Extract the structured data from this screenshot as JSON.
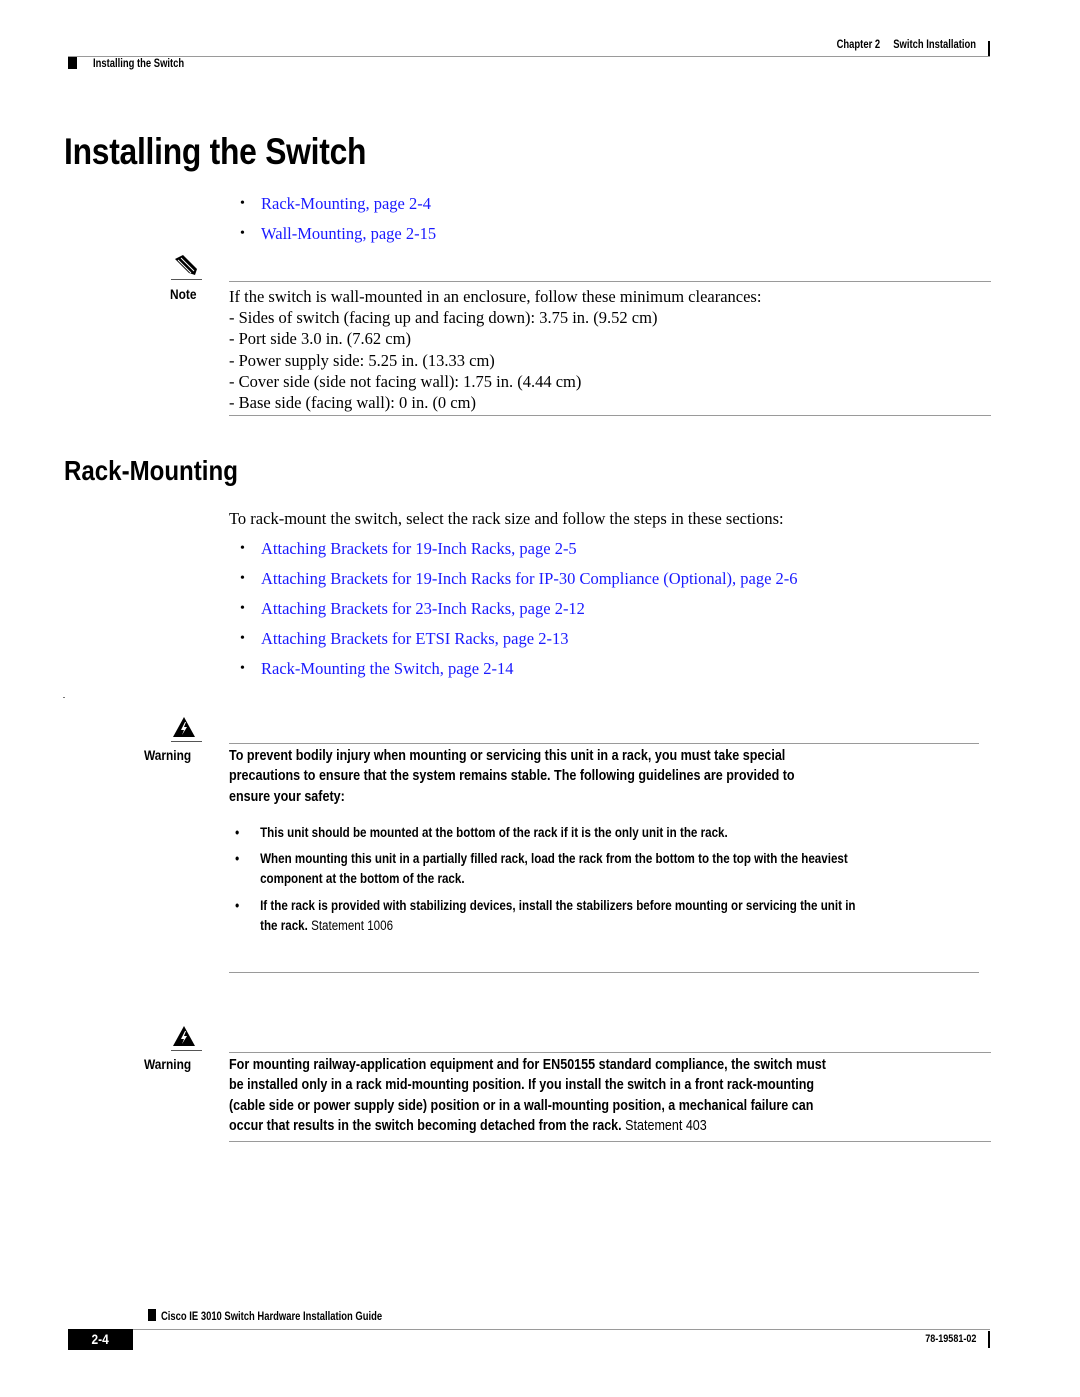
{
  "header": {
    "chapter": "Chapter 2",
    "chapter_title": "Switch Installation",
    "section": "Installing the Switch"
  },
  "title": "Installing the Switch",
  "intro_links": [
    {
      "text": "Rack-Mounting, page 2-4"
    },
    {
      "text": "Wall-Mounting, page 2-15"
    }
  ],
  "note": {
    "icon": "pencil-icon",
    "label": "Note",
    "lines": [
      "If the switch is wall-mounted in an enclosure, follow these minimum clearances:",
      "- Sides of switch (facing up and facing down): 3.75 in. (9.52 cm)",
      "- Port side 3.0 in. (7.62 cm)",
      "- Power supply side: 5.25 in. (13.33 cm)",
      "- Cover side (side not facing wall): 1.75 in. (4.44 cm)",
      "- Base side (facing wall): 0 in. (0 cm)"
    ]
  },
  "rack_section": {
    "heading": "Rack-Mounting",
    "intro": "To rack-mount the switch, select the rack size and follow the steps in these sections:",
    "links": [
      {
        "text": "Attaching Brackets for 19-Inch Racks, page 2-5"
      },
      {
        "text": "Attaching Brackets for 19-Inch Racks for IP-30 Compliance (Optional), page 2-6"
      },
      {
        "text": "Attaching Brackets for 23-Inch Racks, page 2-12"
      },
      {
        "text": "Attaching Brackets for ETSI Racks, page 2-13"
      },
      {
        "text": "Rack-Mounting the Switch, page 2-14"
      }
    ]
  },
  "warning1": {
    "icon": "warning-triangle-icon",
    "label": "Warning",
    "lines": [
      "To prevent bodily injury when mounting or servicing this unit in a rack, you must take special",
      "precautions to ensure that the system remains stable. The following guidelines are provided to",
      "ensure your safety:"
    ],
    "bullets": [
      {
        "lines": [
          "This unit should be mounted at the bottom of the rack if it is the only unit in the rack."
        ]
      },
      {
        "lines": [
          "When mounting this unit in a partially filled rack, load the rack from the bottom to the top with the heaviest",
          "component at the bottom of the rack."
        ]
      },
      {
        "lines": [
          "If the rack is provided with stabilizing devices, install the stabilizers before mounting or servicing the unit in",
          "the rack."
        ],
        "statement": "Statement 1006"
      }
    ]
  },
  "warning2": {
    "icon": "warning-triangle-icon",
    "label": "Warning",
    "lines": [
      "For mounting railway-application equipment and for  EN50155 standard compliance, the switch must",
      "be installed only in a rack mid-mounting position.  If you install the switch in a front rack-mounting",
      "(cable side or power supply side) position or in a wall-mounting position,  a  mechanical failure can",
      "occur that results in the switch becoming detached from the rack."
    ],
    "statement": "Statement 403"
  },
  "footer": {
    "guide_title": "Cisco IE 3010 Switch Hardware Installation Guide",
    "page_number": "2-4",
    "doc_number": "78-19581-02"
  },
  "colors": {
    "link": "#1a1aff",
    "rule": "#9a9a9a",
    "text": "#000000"
  }
}
